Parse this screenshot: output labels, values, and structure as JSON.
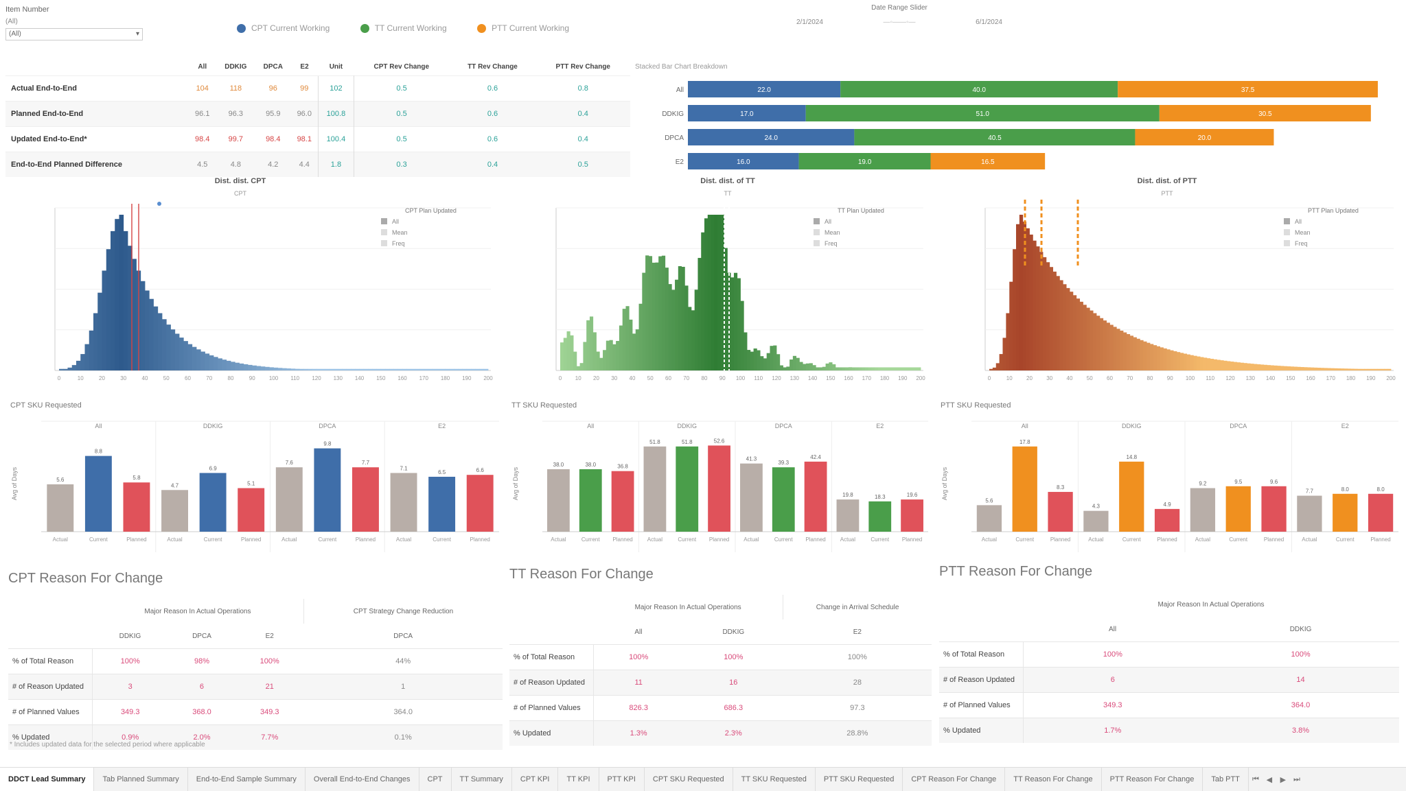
{
  "filter": {
    "title": "Item Number",
    "option": "(All)",
    "value": "(All)"
  },
  "legend": [
    {
      "label": "CPT Current Working",
      "color": "#3f6ea9"
    },
    {
      "label": "TT Current Working",
      "color": "#4a9e4a"
    },
    {
      "label": "PTT Current Working",
      "color": "#f0901f"
    }
  ],
  "range": {
    "title": "Date Range Slider",
    "start": "2/1/2024",
    "end": "6/1/2024"
  },
  "summary": {
    "headers": [
      "All",
      "DDKIG",
      "DPCA",
      "E2",
      "Unit",
      "CPT Rev Change",
      "TT Rev Change",
      "PTT Rev Change"
    ],
    "footnote": "Stacked Bar Chart Breakdown",
    "rows": [
      {
        "label": "Actual End-to-End",
        "cells": [
          "104",
          "118",
          "96",
          "99",
          "102",
          "0.5",
          "0.6",
          "0.8"
        ]
      },
      {
        "label": "Planned End-to-End",
        "cells": [
          "96.1",
          "96.3",
          "95.9",
          "96.0",
          "100.8",
          "0.5",
          "0.6",
          "0.4"
        ]
      },
      {
        "label": "Updated End-to-End*",
        "cells": [
          "98.4",
          "99.7",
          "98.4",
          "98.1",
          "100.4",
          "0.5",
          "0.6",
          "0.4"
        ]
      },
      {
        "label": "End-to-End Planned Difference",
        "cells": [
          "4.5",
          "4.8",
          "4.2",
          "4.4",
          "1.8",
          "0.3",
          "0.4",
          "0.5"
        ]
      }
    ]
  },
  "stacked": {
    "rows": [
      {
        "label": "All",
        "segs": [
          {
            "v": 220,
            "t": "22.0"
          },
          {
            "v": 400,
            "t": "40.0"
          },
          {
            "v": 375,
            "t": "37.5"
          }
        ]
      },
      {
        "label": "DDKIG",
        "segs": [
          {
            "v": 170,
            "t": "17.0"
          },
          {
            "v": 510,
            "t": "51.0"
          },
          {
            "v": 305,
            "t": "30.5"
          }
        ]
      },
      {
        "label": "DPCA",
        "segs": [
          {
            "v": 240,
            "t": "24.0"
          },
          {
            "v": 405,
            "t": "40.5"
          },
          {
            "v": 200,
            "t": "20.0"
          }
        ]
      },
      {
        "label": "E2",
        "segs": [
          {
            "v": 160,
            "t": "16.0"
          },
          {
            "v": 190,
            "t": "19.0"
          },
          {
            "v": 165,
            "t": "16.5"
          }
        ]
      }
    ],
    "colors": [
      "#3f6ea9",
      "#4a9e4a",
      "#f0901f"
    ]
  },
  "hists": [
    {
      "title": "Dist. dist. CPT",
      "sub": "CPT",
      "legend_title": "CPT Plan Updated",
      "leg": [
        "All",
        "Mean",
        "Freq"
      ],
      "dark": "#2e5a8c",
      "light": "#9ec4e6",
      "marks": [
        148,
        158,
        176
      ],
      "markColor": "#d64545"
    },
    {
      "title": "Dist. dist. of TT",
      "sub": "TT",
      "legend_title": "TT Plan Updated",
      "leg": [
        "All",
        "Mean",
        "Freq"
      ],
      "dark": "#2f7d34",
      "light": "#a6d89a",
      "marks": [
        808,
        814
      ],
      "markColor": "#ffffff"
    },
    {
      "title": "Dist. dist. of PTT",
      "sub": "PTT",
      "legend_title": "PTT Plan Updated",
      "leg": [
        "All",
        "Mean",
        "Freq"
      ],
      "dark": "#a8452a",
      "light": "#f4b96a",
      "marks": [
        1143,
        1161,
        1202
      ],
      "markColor": "#f0901f"
    }
  ],
  "bar_groups": [
    {
      "title": "CPT SKU Requested",
      "groups": [
        "All",
        "DDKIG",
        "DPCA",
        "E2"
      ],
      "ylabel": "Avg of Days",
      "bars": [
        {
          "v": 50,
          "t": "5.6",
          "c": "#b8aea8",
          "x": "Actual"
        },
        {
          "v": 80,
          "t": "8.8",
          "c": "#3f6ea9",
          "x": "Current"
        },
        {
          "v": 52,
          "t": "5.8",
          "c": "#e0525a",
          "x": "Planned"
        },
        {
          "v": 44,
          "t": "4.7",
          "c": "#b8aea8",
          "x": "Actual"
        },
        {
          "v": 62,
          "t": "6.9",
          "c": "#3f6ea9",
          "x": "Current"
        },
        {
          "v": 46,
          "t": "5.1",
          "c": "#e0525a",
          "x": "Planned"
        },
        {
          "v": 68,
          "t": "7.6",
          "c": "#b8aea8",
          "x": "Actual"
        },
        {
          "v": 88,
          "t": "9.8",
          "c": "#3f6ea9",
          "x": "Current"
        },
        {
          "v": 68,
          "t": "7.7",
          "c": "#e0525a",
          "x": "Planned"
        },
        {
          "v": 62,
          "t": "7.1",
          "c": "#b8aea8",
          "x": "Actual"
        },
        {
          "v": 58,
          "t": "6.5",
          "c": "#3f6ea9",
          "x": "Current"
        },
        {
          "v": 60,
          "t": "6.6",
          "c": "#e0525a",
          "x": "Planned"
        }
      ]
    },
    {
      "title": "TT SKU Requested",
      "groups": [
        "All",
        "DDKIG",
        "DPCA",
        "E2"
      ],
      "ylabel": "Avg of Days",
      "bars": [
        {
          "v": 66,
          "t": "38.0",
          "c": "#b8aea8",
          "x": "Actual"
        },
        {
          "v": 66,
          "t": "38.0",
          "c": "#4a9e4a",
          "x": "Current"
        },
        {
          "v": 64,
          "t": "36.8",
          "c": "#e0525a",
          "x": "Planned"
        },
        {
          "v": 90,
          "t": "51.8",
          "c": "#b8aea8",
          "x": "Actual"
        },
        {
          "v": 90,
          "t": "51.8",
          "c": "#4a9e4a",
          "x": "Current"
        },
        {
          "v": 91,
          "t": "52.6",
          "c": "#e0525a",
          "x": "Planned"
        },
        {
          "v": 72,
          "t": "41.3",
          "c": "#b8aea8",
          "x": "Actual"
        },
        {
          "v": 68,
          "t": "39.3",
          "c": "#4a9e4a",
          "x": "Current"
        },
        {
          "v": 74,
          "t": "42.4",
          "c": "#e0525a",
          "x": "Planned"
        },
        {
          "v": 34,
          "t": "19.8",
          "c": "#b8aea8",
          "x": "Actual"
        },
        {
          "v": 32,
          "t": "18.3",
          "c": "#4a9e4a",
          "x": "Current"
        },
        {
          "v": 34,
          "t": "19.6",
          "c": "#e0525a",
          "x": "Planned"
        }
      ]
    },
    {
      "title": "PTT SKU Requested",
      "groups": [
        "All",
        "DDKIG",
        "DPCA",
        "E2"
      ],
      "ylabel": "Avg of Days",
      "bars": [
        {
          "v": 28,
          "t": "5.6",
          "c": "#b8aea8",
          "x": "Actual"
        },
        {
          "v": 90,
          "t": "17.8",
          "c": "#f0901f",
          "x": "Current"
        },
        {
          "v": 42,
          "t": "8.3",
          "c": "#e0525a",
          "x": "Planned"
        },
        {
          "v": 22,
          "t": "4.3",
          "c": "#b8aea8",
          "x": "Actual"
        },
        {
          "v": 74,
          "t": "14.8",
          "c": "#f0901f",
          "x": "Current"
        },
        {
          "v": 24,
          "t": "4.9",
          "c": "#e0525a",
          "x": "Planned"
        },
        {
          "v": 46,
          "t": "9.2",
          "c": "#b8aea8",
          "x": "Actual"
        },
        {
          "v": 48,
          "t": "9.5",
          "c": "#f0901f",
          "x": "Current"
        },
        {
          "v": 48,
          "t": "9.6",
          "c": "#e0525a",
          "x": "Planned"
        },
        {
          "v": 38,
          "t": "7.7",
          "c": "#b8aea8",
          "x": "Actual"
        },
        {
          "v": 40,
          "t": "8.0",
          "c": "#f0901f",
          "x": "Current"
        },
        {
          "v": 40,
          "t": "8.0",
          "c": "#e0525a",
          "x": "Planned"
        }
      ]
    }
  ],
  "reasons": [
    {
      "title": "CPT Reason For Change",
      "group_hdr": "Major Reason In Actual Operations",
      "extra_hdr": "CPT Strategy Change Reduction",
      "cols": [
        "DDKIG",
        "DPCA",
        "E2",
        "DPCA"
      ],
      "rows": [
        {
          "label": "% of Total Reason",
          "cells": [
            "100%",
            "98%",
            "100%",
            "44%"
          ]
        },
        {
          "label": "# of Reason Updated",
          "cells": [
            "3",
            "6",
            "21",
            "1"
          ]
        },
        {
          "label": "# of Planned Values",
          "cells": [
            "349.3",
            "368.0",
            "349.3",
            "364.0"
          ]
        },
        {
          "label": "% Updated",
          "cells": [
            "0.9%",
            "2.0%",
            "7.7%",
            "0.1%"
          ]
        }
      ]
    },
    {
      "title": "TT Reason For Change",
      "group_hdr": "Major Reason In Actual Operations",
      "extra_hdr": "Change in Arrival Schedule",
      "cols": [
        "All",
        "DDKIG",
        "E2"
      ],
      "rows": [
        {
          "label": "% of Total Reason",
          "cells": [
            "100%",
            "100%",
            "100%"
          ]
        },
        {
          "label": "# of Reason Updated",
          "cells": [
            "11",
            "16",
            "28"
          ]
        },
        {
          "label": "# of Planned Values",
          "cells": [
            "826.3",
            "686.3",
            "97.3"
          ]
        },
        {
          "label": "% Updated",
          "cells": [
            "1.3%",
            "2.3%",
            "28.8%"
          ]
        }
      ]
    },
    {
      "title": "PTT Reason For Change",
      "group_hdr": "Major Reason In Actual Operations",
      "extra_hdr": "",
      "cols": [
        "All",
        "DDKIG"
      ],
      "rows": [
        {
          "label": "% of Total Reason",
          "cells": [
            "100%",
            "100%"
          ]
        },
        {
          "label": "# of Reason Updated",
          "cells": [
            "6",
            "14"
          ]
        },
        {
          "label": "# of Planned Values",
          "cells": [
            "349.3",
            "364.0"
          ]
        },
        {
          "label": "% Updated",
          "cells": [
            "1.7%",
            "3.8%"
          ]
        }
      ]
    }
  ],
  "footnote": "* Includes updated data for the selected period where applicable",
  "tabs": [
    "DDCT Lead Summary",
    "Tab Planned Summary",
    "End-to-End Sample Summary",
    "Overall End-to-End Changes",
    "CPT",
    "TT Summary",
    "CPT KPI",
    "TT KPI",
    "PTT KPI",
    "CPT SKU Requested",
    "TT SKU Requested",
    "PTT SKU Requested",
    "CPT Reason For Change",
    "TT Reason For Change",
    "PTT Reason For Change",
    "Tab PTT"
  ]
}
